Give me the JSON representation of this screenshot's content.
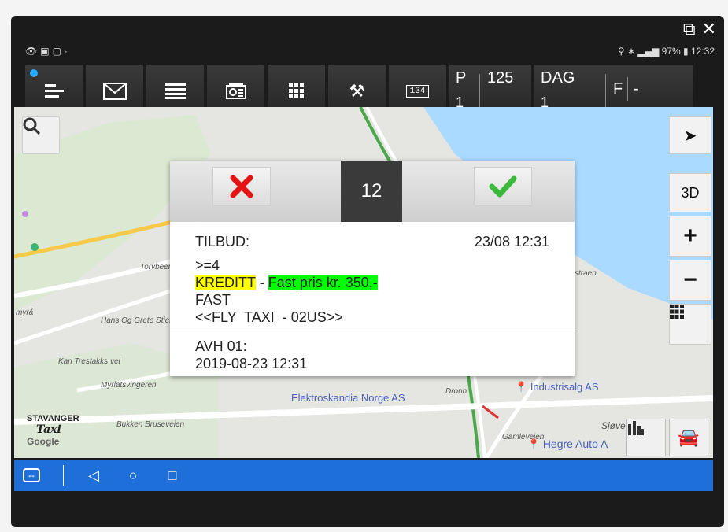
{
  "window": {
    "popout_icon": "popout-icon",
    "close_icon": "close-icon"
  },
  "statusbar": {
    "right_text": "97% ▮ 12:32"
  },
  "toolbar": {
    "display_label": "134",
    "p_label": "P",
    "p_value": "1",
    "p_count": "125",
    "dag_label": "DAG",
    "dag_value": "1",
    "f_label": "F",
    "f_value": "-"
  },
  "map": {
    "controls": {
      "three_d": "3D",
      "plus": "+",
      "minus": "−"
    },
    "labels": {
      "torvbeen": "Torvbeen",
      "hans": "Hans Og Grete Stien",
      "kari": "Kari Trestakks vei",
      "myra": "myrå",
      "straen": "straen",
      "sjove": "Sjøve",
      "mydal": "Myrlatsvingeren",
      "bukken": "Bukken Bruseveien",
      "dronn": "Dronn",
      "gamle": "Gamleveien"
    },
    "pois": {
      "elektro": "Elektroskandia Norge AS",
      "industri": "Industrisalg AS",
      "hegre": "Hegre Auto A"
    },
    "brand_line1": "STAVANGER",
    "brand_line2": "Taxi",
    "google": "Google"
  },
  "dialog": {
    "count": "12",
    "title": "TILBUD:",
    "time": "23/08 12:31",
    "line1": ">=4",
    "kreditt": "KREDITT",
    "sep": " - ",
    "fastpris": "Fast pris kr. 350,-",
    "line3": "FAST",
    "line4": "<<FLY  TAXI  - 02US>>",
    "avh": "AVH 01:",
    "avh_value": "2019-08-23 12:31"
  },
  "colors": {
    "accent": "#1e6fd9",
    "dark": "#262626",
    "highlight_yellow": "#ffff00",
    "highlight_green": "#00ff00"
  }
}
